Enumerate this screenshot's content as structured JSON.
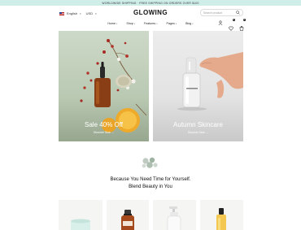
{
  "announcement": "Worldwide shipping · free shipping on orders over $100",
  "header": {
    "language": "English",
    "currency": "USD",
    "logo": "GLOWING",
    "search_placeholder": "Search product",
    "wishlist_count": "0",
    "cart_count": "0"
  },
  "nav": [
    {
      "label": "Home"
    },
    {
      "label": "Shop"
    },
    {
      "label": "Features"
    },
    {
      "label": "Pages"
    },
    {
      "label": "Blog"
    }
  ],
  "banners": [
    {
      "title": "Sale 40% Off",
      "link": "Discover Now"
    },
    {
      "title": "Autumn Skincare",
      "link": "Discover Now"
    }
  ],
  "tagline": {
    "line1": "Because You Need Time for Yourself.",
    "line2": "Blend Beauty in You"
  }
}
